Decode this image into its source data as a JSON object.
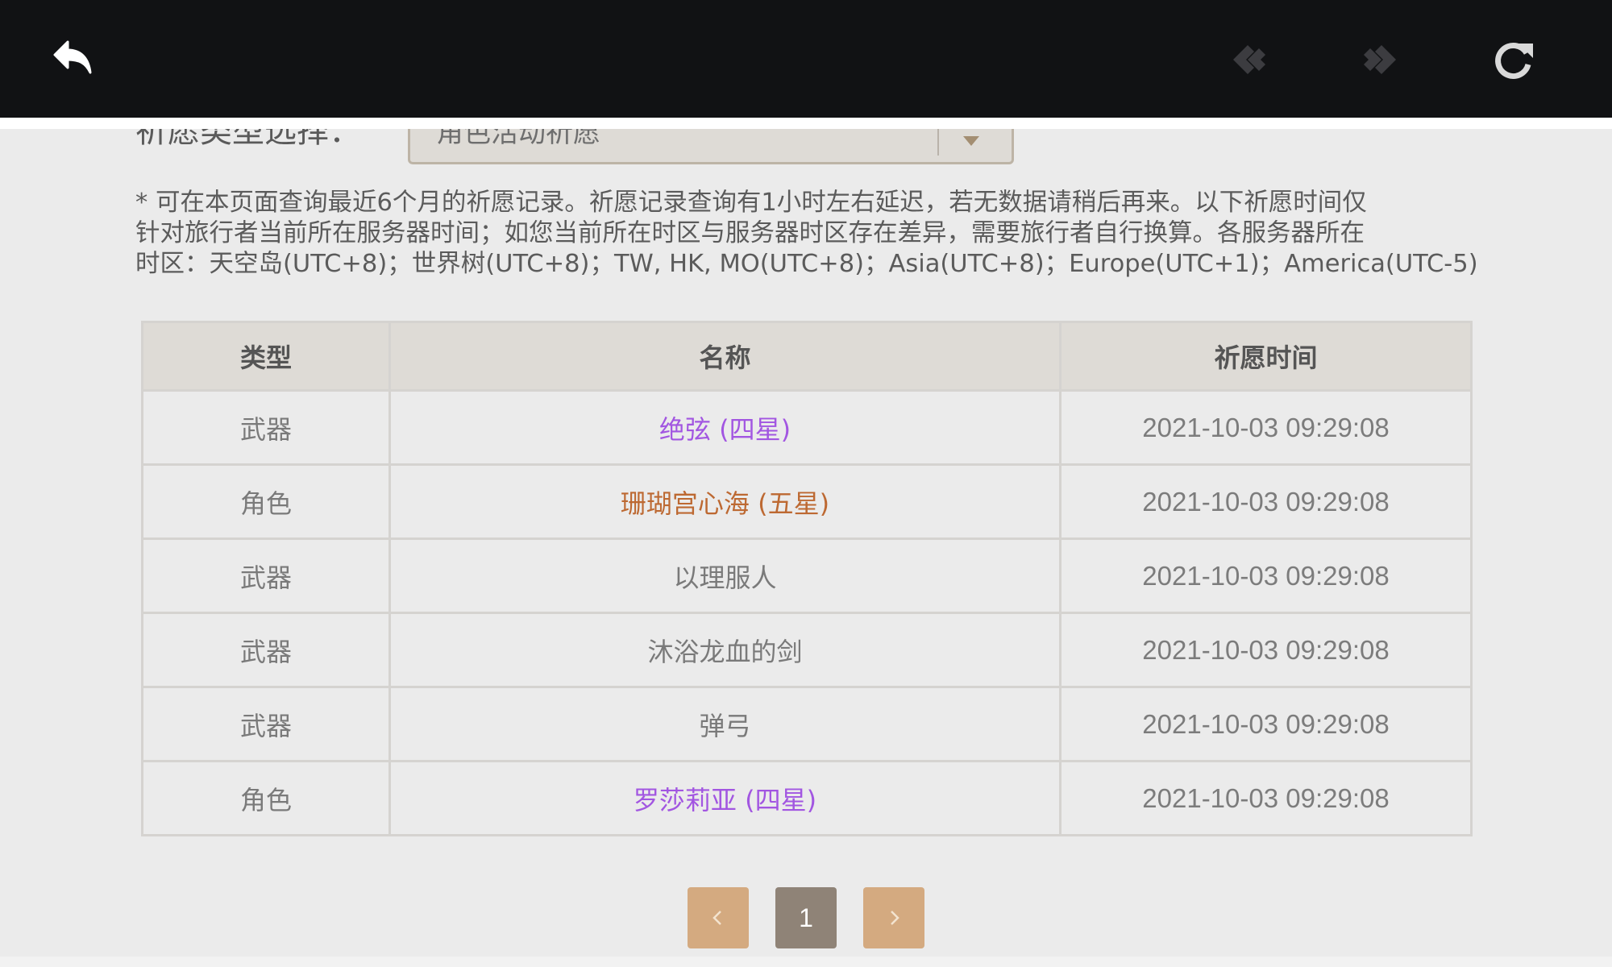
{
  "filter": {
    "label": "祈愿类型选择：",
    "selected": "角色活动祈愿"
  },
  "notice_lines": [
    "* 可在本页面查询最近6个月的祈愿记录。祈愿记录查询有1小时左右延迟，若无数据请稍后再来。以下祈愿时间仅",
    "针对旅行者当前所在服务器时间；如您当前所在时区与服务器时区存在差异，需要旅行者自行换算。各服务器所在",
    "时区：天空岛(UTC+8)；世界树(UTC+8)；TW, HK, MO(UTC+8)；Asia(UTC+8)；Europe(UTC+1)；America(UTC-5)"
  ],
  "table": {
    "headers": [
      "类型",
      "名称",
      "祈愿时间"
    ],
    "rows": [
      {
        "type": "武器",
        "name": "绝弦 (四星)",
        "time": "2021-10-03 09:29:08",
        "color": "#a256e1"
      },
      {
        "type": "角色",
        "name": "珊瑚宫心海 (五星)",
        "time": "2021-10-03 09:29:08",
        "color": "#bd6932"
      },
      {
        "type": "武器",
        "name": "以理服人",
        "time": "2021-10-03 09:29:08",
        "color": "#7a7a7a"
      },
      {
        "type": "武器",
        "name": "沐浴龙血的剑",
        "time": "2021-10-03 09:29:08",
        "color": "#7a7a7a"
      },
      {
        "type": "武器",
        "name": "弹弓",
        "time": "2021-10-03 09:29:08",
        "color": "#7a7a7a"
      },
      {
        "type": "角色",
        "name": "罗莎莉亚 (四星)",
        "time": "2021-10-03 09:29:08",
        "color": "#a256e1"
      }
    ]
  },
  "pagination": {
    "current_page": "1"
  },
  "icons": {
    "back": "back-arrow-icon",
    "prev_page": "nav-back-icon",
    "next_page": "nav-forward-icon",
    "refresh": "refresh-icon"
  },
  "colors": {
    "topbar": "#111214",
    "four_star": "#a256e1",
    "five_star": "#bd6932",
    "pager_nav": "#d4aa80",
    "pager_current": "#8f8377"
  }
}
